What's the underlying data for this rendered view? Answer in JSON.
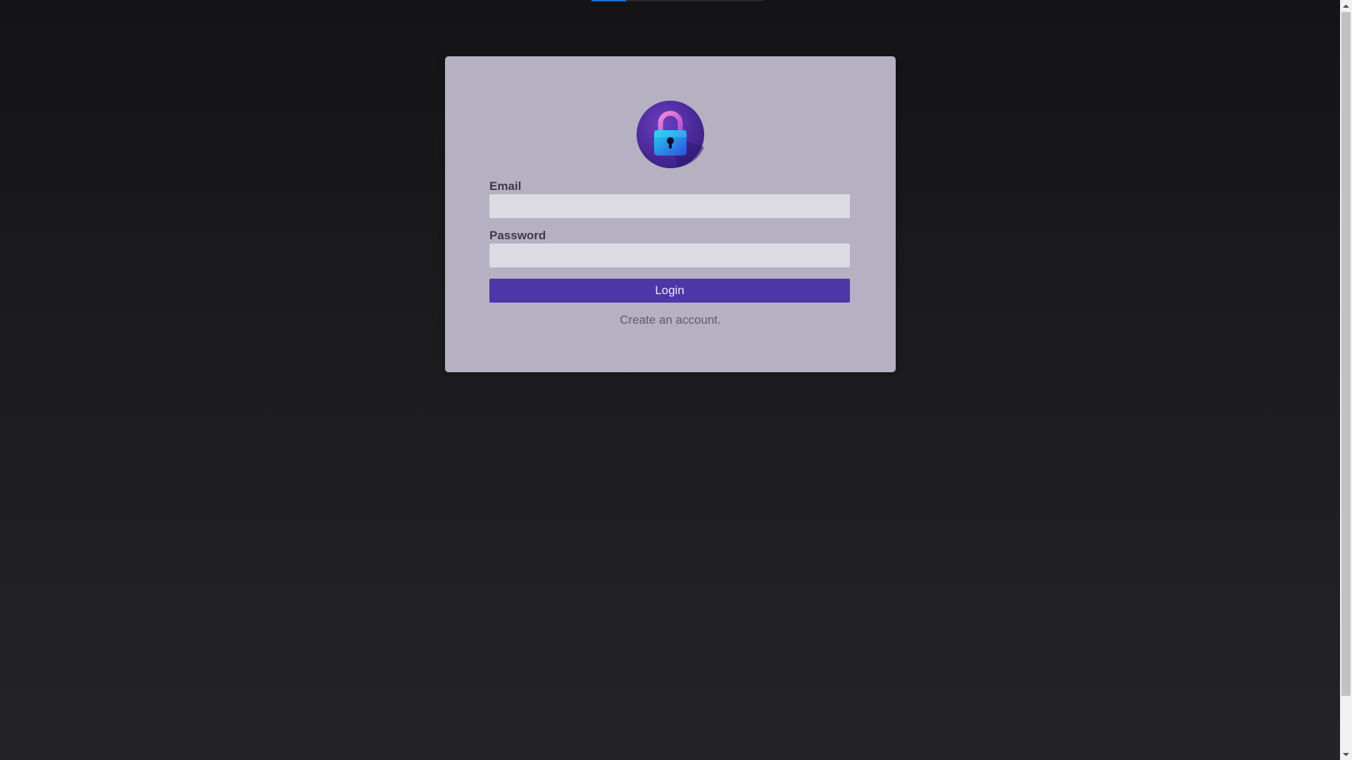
{
  "page": {
    "top_progress": {
      "value_percent": 20,
      "color": "#1e6fd0"
    }
  },
  "login": {
    "logo_icon": "lock-icon",
    "email_label": "Email",
    "email_value": "",
    "email_placeholder": "",
    "password_label": "Password",
    "password_value": "",
    "password_placeholder": "",
    "login_button": "Login",
    "create_account_link": "Create an account."
  },
  "colors": {
    "card_background": "#b6b1c2",
    "button_background": "#4c37a8",
    "input_background": "#dcdae2",
    "page_background": "#1c1c1f"
  },
  "scrollbar": {
    "up_icon": "scroll-up-arrow-icon",
    "down_icon": "scroll-down-arrow-icon"
  }
}
